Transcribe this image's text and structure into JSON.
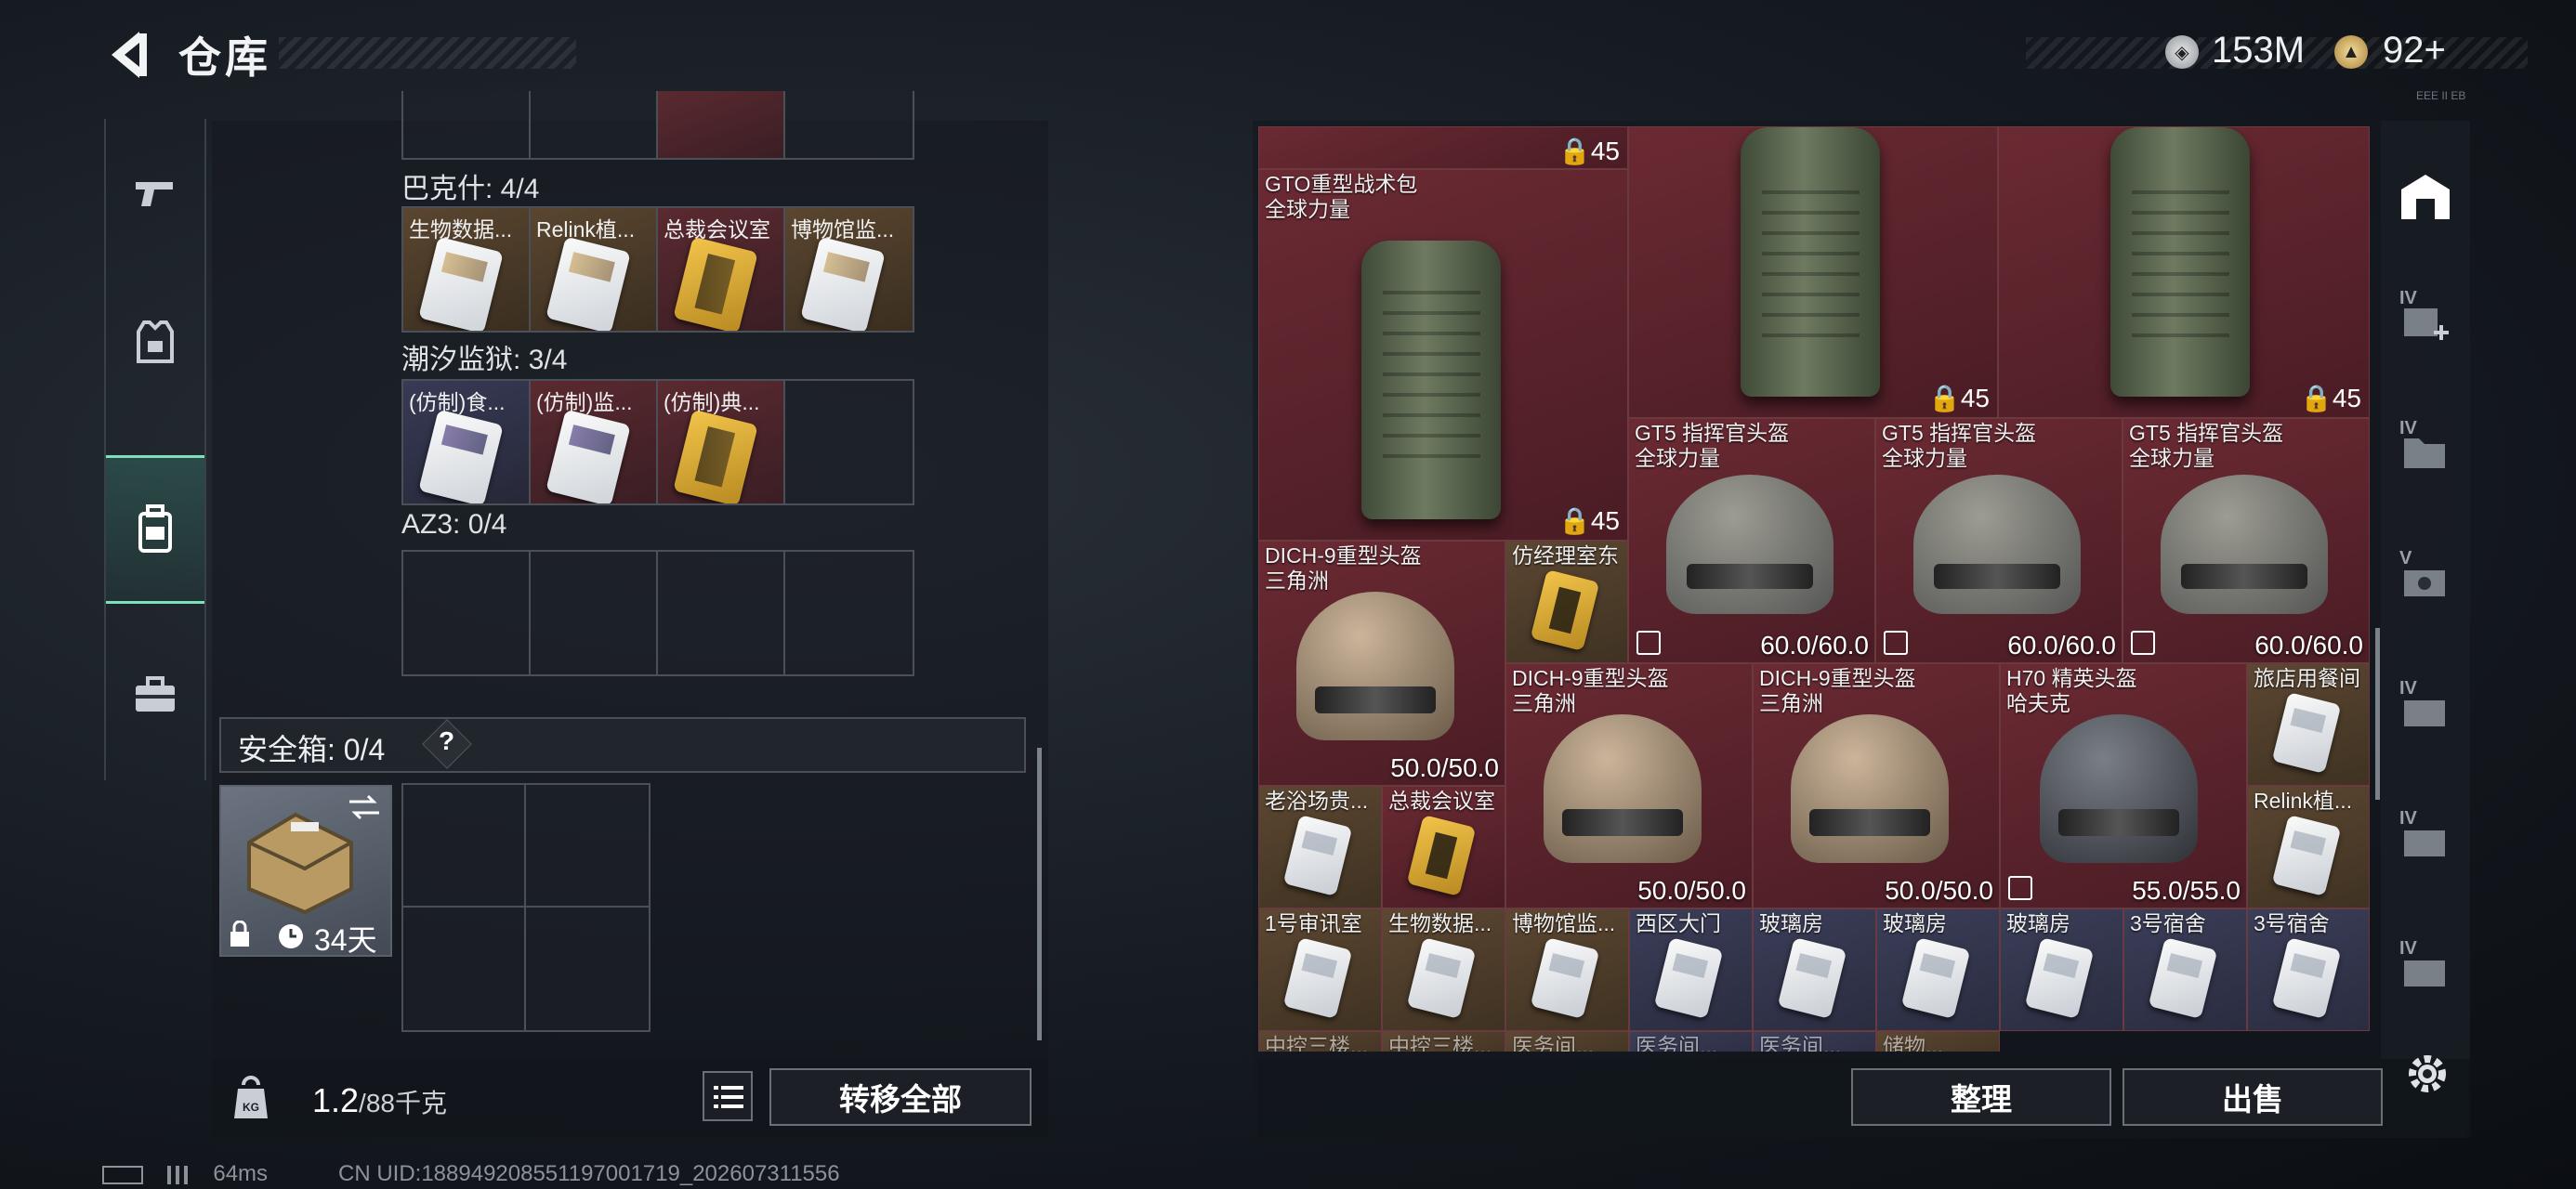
{
  "header": {
    "title": "仓库",
    "currency1": "153M",
    "currency2": "92+",
    "tiny": "EEE II EB"
  },
  "left_nav": [
    "weapon-tab",
    "armor-tab",
    "container-tab",
    "toolbox-tab"
  ],
  "collections": [
    {
      "label": "巴克什: 4/4",
      "items": [
        {
          "name": "生物数据...",
          "rarity": "orange"
        },
        {
          "name": "Relink植...",
          "rarity": "orange"
        },
        {
          "name": "总裁会议室",
          "rarity": "red"
        },
        {
          "name": "博物馆监...",
          "rarity": "orange"
        }
      ]
    },
    {
      "label": "潮汐监狱: 3/4",
      "items": [
        {
          "name": "(仿制)食...",
          "rarity": "purple"
        },
        {
          "name": "(仿制)监...",
          "rarity": "red"
        },
        {
          "name": "(仿制)典...",
          "rarity": "red"
        },
        {
          "name": "",
          "rarity": "empty"
        }
      ]
    },
    {
      "label": "AZ3: 0/4",
      "items": [
        {
          "name": "",
          "rarity": "empty"
        },
        {
          "name": "",
          "rarity": "empty"
        },
        {
          "name": "",
          "rarity": "empty"
        },
        {
          "name": "",
          "rarity": "empty"
        }
      ]
    }
  ],
  "safe_box": {
    "label": "安全箱: 0/4",
    "help": "?",
    "days": "34天"
  },
  "left_bottom": {
    "weight": "1.2",
    "weight_max": "/88千克",
    "kg": "KG",
    "transfer": "转移全部"
  },
  "status": {
    "ping": "64ms",
    "uid": "CN UID:1889492085511970017​19_202607311556"
  },
  "inventory": {
    "cap45": "45",
    "gto_bag": {
      "name": "GTO重型战术包",
      "sub": "全球力量"
    },
    "gt5": {
      "name": "GT5 指挥官头盔",
      "sub": "全球力量",
      "dur": "60.0/60.0"
    },
    "dich9": {
      "name": "DICH-9重型头盔",
      "sub": "三角洲",
      "dur": "50.0/50.0"
    },
    "h70": {
      "name": "H70 精英头盔",
      "sub": "哈夫克",
      "dur": "55.0/55.0"
    },
    "cards": {
      "fangjingli": "仿经理室东",
      "lvdian": "旅店用餐间",
      "laoyu": "老浴场贵...",
      "zongcai": "总裁会议室",
      "relink": "Relink植...",
      "row": [
        "1号审讯室",
        "生物数据...",
        "博物馆监...",
        "西区大门",
        "玻璃房",
        "玻璃房",
        "玻璃房",
        "3号宿舍",
        "3号宿舍"
      ],
      "row2": [
        "中控三楼...",
        "中控三楼...",
        "医务间...",
        "医务间...",
        "医务间...",
        "储物..."
      ]
    }
  },
  "right_bottom": {
    "sort": "整理",
    "sell": "出售"
  },
  "right_tabs": [
    "IV",
    "IV",
    "IV",
    "V",
    "IV",
    "IV",
    "IV"
  ]
}
